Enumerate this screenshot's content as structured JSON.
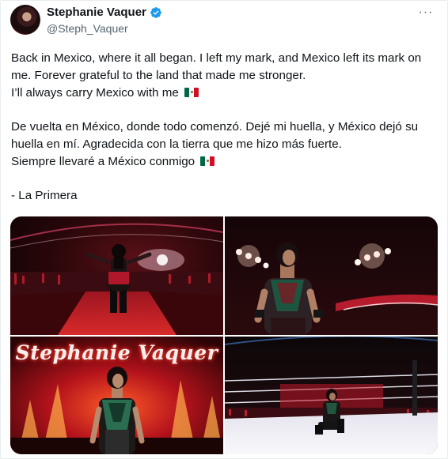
{
  "post": {
    "author": {
      "display_name": "Stephanie Vaquer",
      "handle": "@Steph_Vaquer",
      "verified": true
    },
    "more_label": "···",
    "paragraphs": {
      "en_1": "Back in Mexico, where it all began. I left my mark, and Mexico left its mark on me. Forever grateful to the land that made me stronger.",
      "en_2": "I’ll always carry Mexico with me",
      "es_1": "De vuelta en México, donde todo comenzó. Dejé mi huella, y México dejó su huella en mí. Agradecida con la tierra que me hizo más fuerte.",
      "es_2": "Siempre llevaré a México conmigo",
      "sign": "- La Primera"
    },
    "emoji": "mexico-flag"
  },
  "media": {
    "count": 4,
    "overlay_title": "Stephanie Vaquer"
  },
  "colors": {
    "text": "#0f1419",
    "muted": "#536471",
    "verified": "#1d9bf0",
    "ring_red": "#c0141a"
  }
}
